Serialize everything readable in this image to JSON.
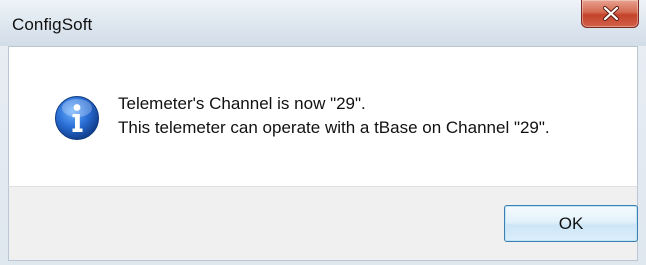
{
  "window": {
    "title": "ConfigSoft",
    "close_icon": "close-icon"
  },
  "message": {
    "icon": "info-icon",
    "line1": "Telemeter's Channel is now \"29\".",
    "line2": "This telemeter can operate with a tBase on Channel \"29\"."
  },
  "buttons": {
    "ok_label": "OK"
  },
  "colors": {
    "close_button": "#c9462f",
    "ok_border": "#3c7fb1",
    "info_icon": "#1f63c6"
  }
}
